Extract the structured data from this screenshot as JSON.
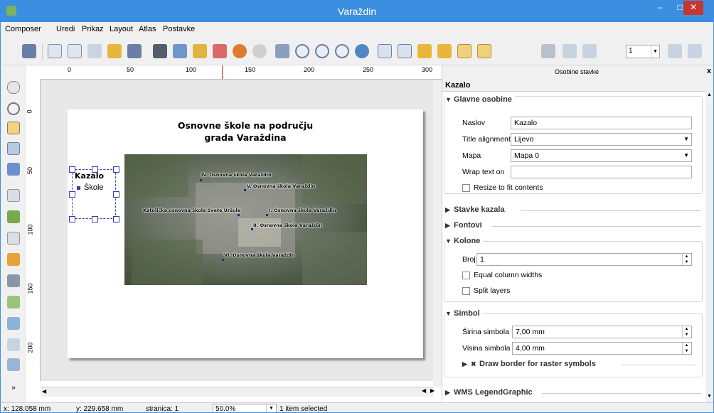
{
  "window": {
    "title": "Varaždin",
    "min": "–",
    "max": "□",
    "close": "✕"
  },
  "menu": [
    "Composer",
    "Uredi",
    "Prikaz",
    "Layout",
    "Atlas",
    "Postavke"
  ],
  "toolbar": {
    "page_value": "1"
  },
  "ruler": {
    "top_labels": [
      "0",
      "50",
      "100",
      "150",
      "200",
      "250",
      "300"
    ],
    "left_labels": [
      "0",
      "50",
      "100",
      "150",
      "200"
    ]
  },
  "composition": {
    "title_line1": "Osnovne škole na području",
    "title_line2": "grada Varaždina",
    "legend_title": "Kazalo",
    "legend_item": "Škole",
    "map_labels": [
      "IV. Osnovna škola Varaždin",
      "V. Osnovna škola Varaždin",
      "Katolička osnovna škola Svete Uršule",
      "I. Osnovna škola Varaždin",
      "II. Osnovna škola Varaždin",
      "VI. Osnovna škola Varaždin"
    ]
  },
  "panel": {
    "header": "Osobine stavke",
    "item_name": "Kazalo",
    "sections": {
      "main": "Glavne osobine",
      "items": "Stavke kazala",
      "fonts": "Fontovi",
      "columns": "Kolone",
      "symbol": "Simbol",
      "wms": "WMS LegendGraphic"
    },
    "main": {
      "naslov_label": "Naslov",
      "naslov_value": "Kazalo",
      "align_label": "Title alignment",
      "align_value": "Lijevo",
      "mapa_label": "Mapa",
      "mapa_value": "Mapa 0",
      "wrap_label": "Wrap text on",
      "wrap_value": "",
      "resize_label": "Resize to fit contents"
    },
    "columns": {
      "broj_label": "Broj",
      "broj_value": "1",
      "equal_label": "Equal column widths",
      "split_label": "Split layers"
    },
    "symbol": {
      "width_label": "Širina simbola",
      "width_value": "7,00 mm",
      "height_label": "Visina simbola",
      "height_value": "4,00 mm",
      "border_label": "Draw border for raster symbols"
    }
  },
  "status": {
    "x": "x: 128.058 mm",
    "y": "y: 229.658 mm",
    "page": "stranica: 1",
    "zoom": "50.0%",
    "selected": "1 item selected"
  }
}
